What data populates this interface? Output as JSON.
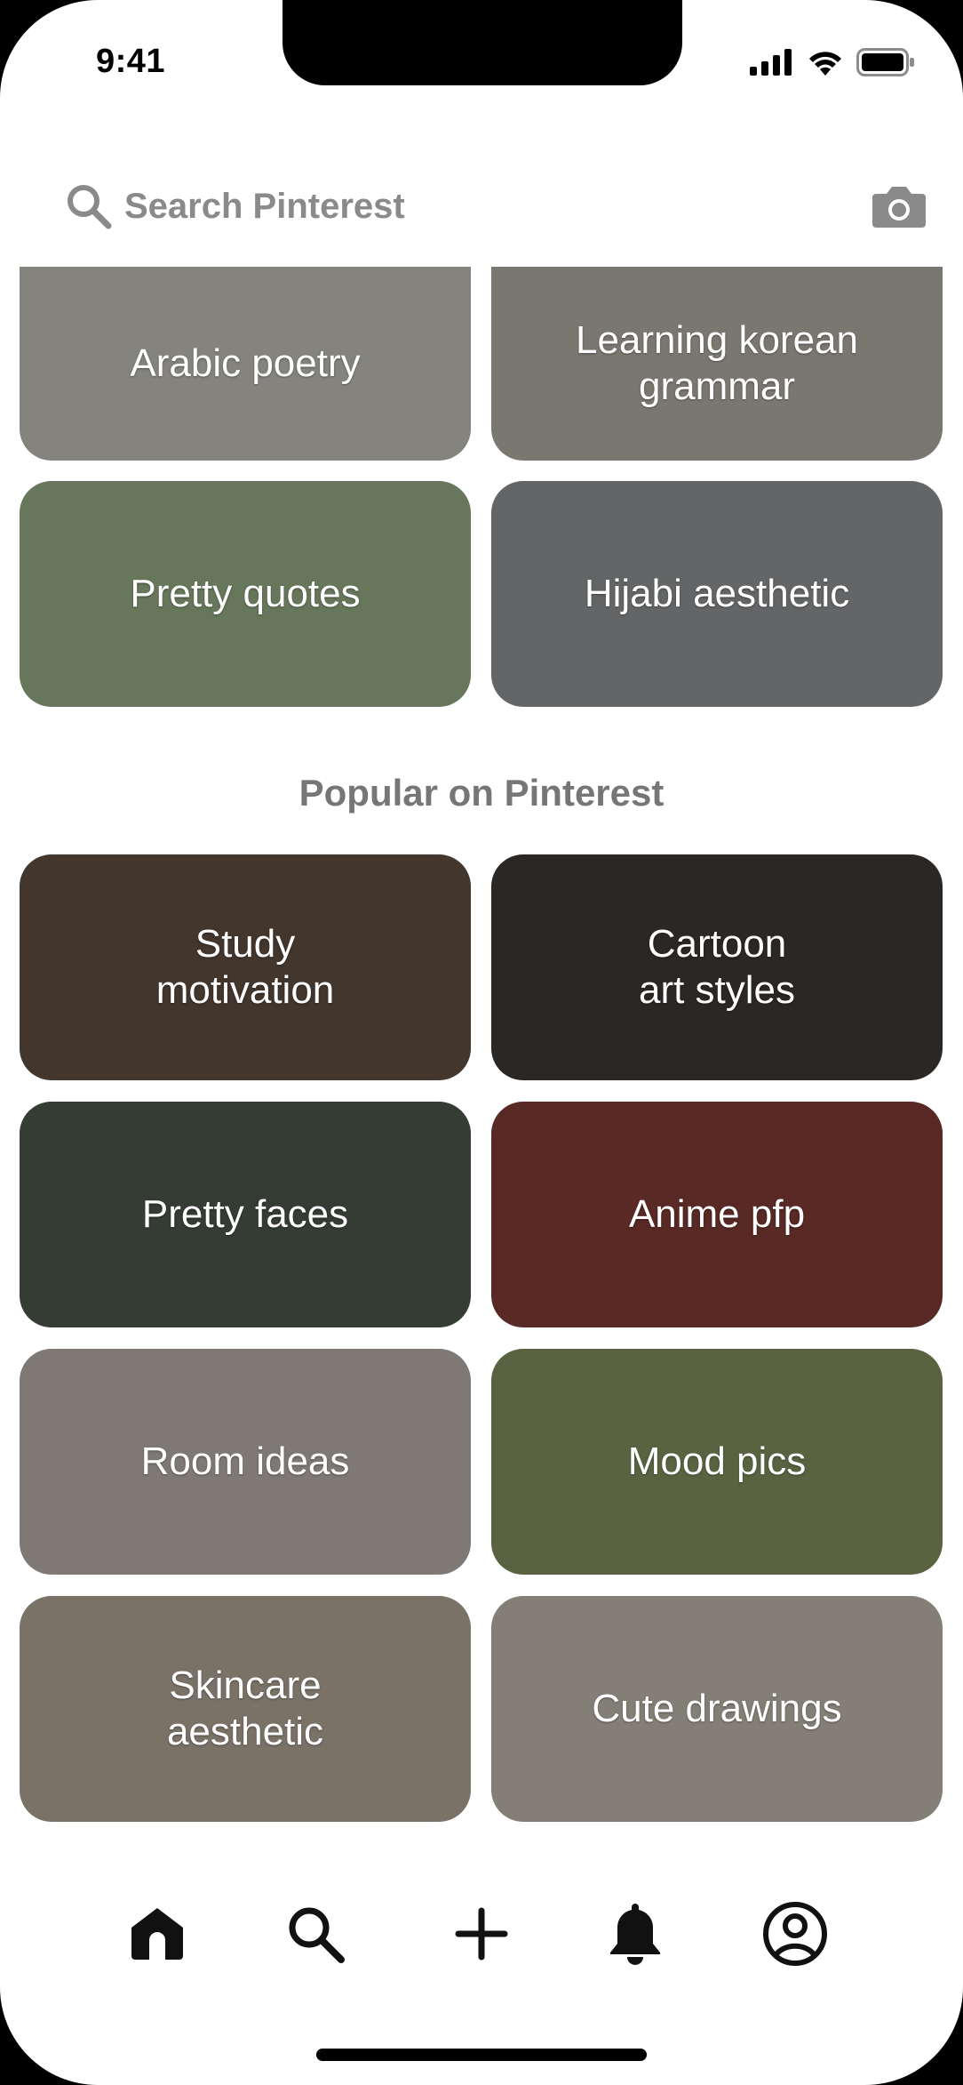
{
  "status": {
    "time": "9:41"
  },
  "search": {
    "placeholder": "Search Pinterest",
    "search_icon": "search-icon",
    "camera_icon": "camera-icon"
  },
  "ideas": [
    {
      "label": "Arabic poetry",
      "bg": "#b9b6ae"
    },
    {
      "label": "Learning korean grammar",
      "bg": "#a9a59c"
    },
    {
      "label": "Pretty quotes",
      "bg": "#8fa67f"
    },
    {
      "label": "Hijabi aesthetic",
      "bg": "#8a8c8f"
    }
  ],
  "popular": {
    "title": "Popular on Pinterest",
    "items": [
      {
        "label": "Study motivation",
        "bg": "#5c4b3f"
      },
      {
        "label": "Cartoon art styles",
        "bg": "#3c3633"
      },
      {
        "label": "Pretty faces",
        "bg": "#4a5448"
      },
      {
        "label": "Anime pfp",
        "bg": "#7a3a34"
      },
      {
        "label": "Room ideas",
        "bg": "#b0a8a4"
      },
      {
        "label": "Mood pics",
        "bg": "#7d8a5a"
      },
      {
        "label": "Skincare aesthetic",
        "bg": "#a99d8f"
      },
      {
        "label": "Cute drawings",
        "bg": "#b6b0a6"
      }
    ]
  },
  "nav": {
    "items": [
      "home-icon",
      "search-icon",
      "add-icon",
      "bell-icon",
      "profile-icon"
    ]
  }
}
